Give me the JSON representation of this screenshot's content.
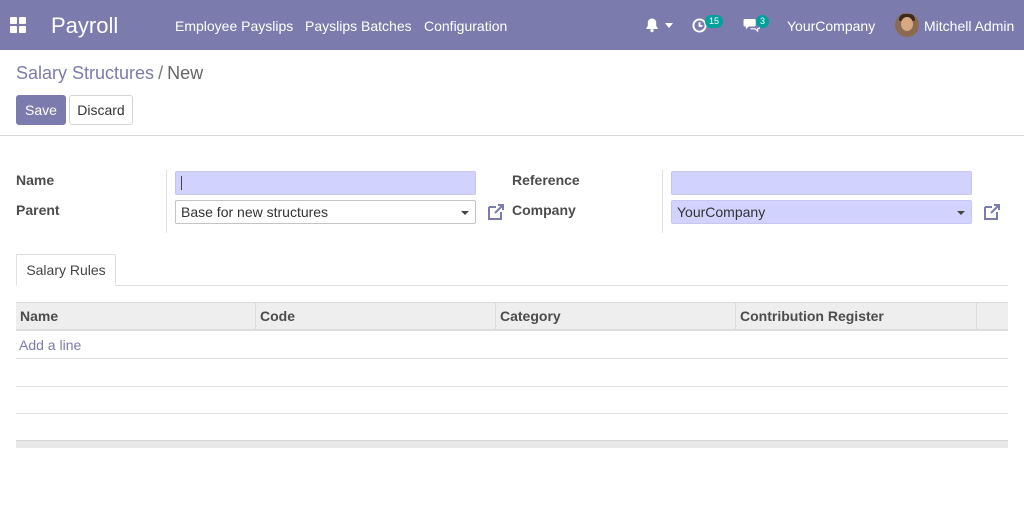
{
  "navbar": {
    "app_name": "Payroll",
    "menu": [
      "Employee Payslips",
      "Payslips Batches",
      "Configuration"
    ],
    "activity_badge": "15",
    "messages_badge": "3",
    "company": "YourCompany",
    "user": "Mitchell Admin",
    "color": "#7c7bad"
  },
  "breadcrumb": {
    "parent": "Salary Structures",
    "separator": "/",
    "current": "New"
  },
  "buttons": {
    "save": "Save",
    "discard": "Discard"
  },
  "form": {
    "name_label": "Name",
    "name_value": "",
    "parent_label": "Parent",
    "parent_value": "Base for new structures",
    "reference_label": "Reference",
    "reference_value": "",
    "company_label": "Company",
    "company_value": "YourCompany"
  },
  "tabs": [
    "Salary Rules"
  ],
  "table": {
    "columns": [
      "Name",
      "Code",
      "Category",
      "Contribution Register"
    ],
    "add_line": "Add a line"
  },
  "icons": {
    "apps": "apps-grid-icon",
    "bell": "bell-icon",
    "activity": "clock-icon",
    "messages": "chat-icon",
    "external": "external-link-icon"
  }
}
